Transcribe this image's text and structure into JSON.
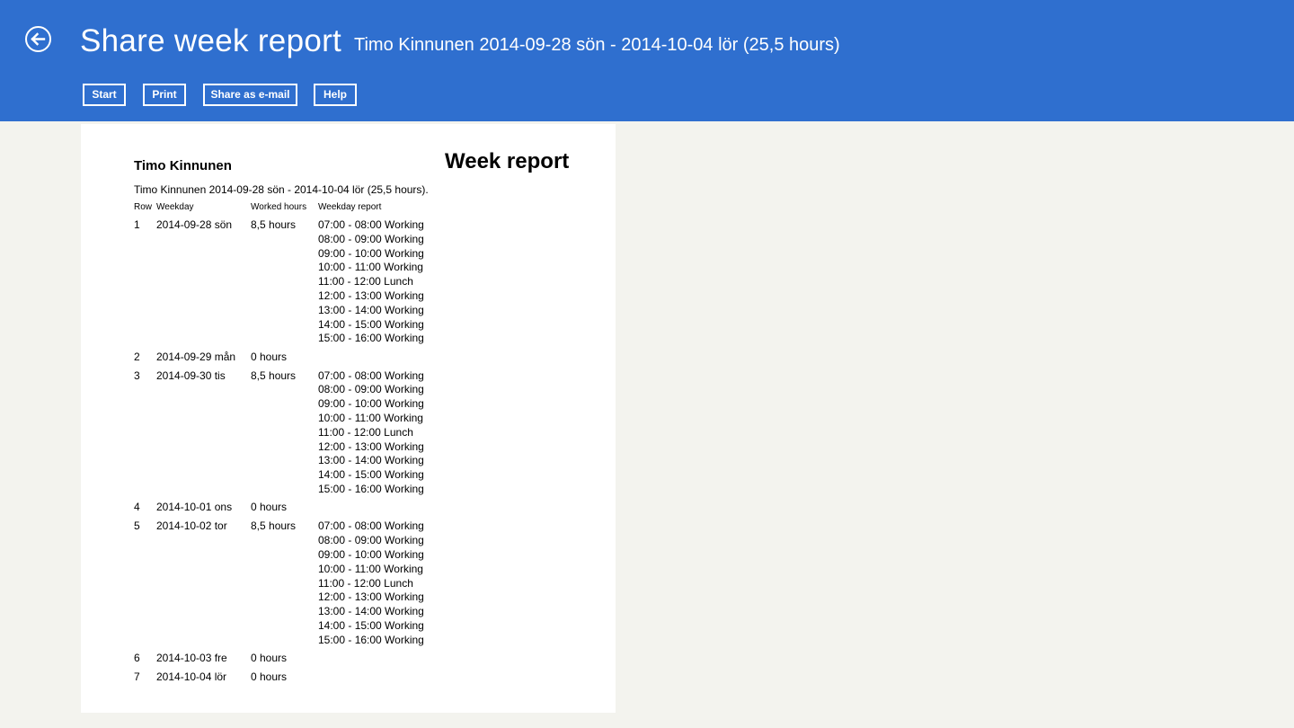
{
  "header": {
    "title": "Share week report",
    "subtitle": "Timo Kinnunen 2014-09-28 sön - 2014-10-04 lör (25,5 hours)",
    "back_icon": "back-arrow-circle-icon"
  },
  "toolbar": {
    "start_label": "Start",
    "print_label": "Print",
    "share_label": "Share as e-mail",
    "help_label": "Help"
  },
  "report": {
    "name": "Timo Kinnunen",
    "heading": "Week report",
    "summary": "Timo Kinnunen 2014-09-28 sön - 2014-10-04 lör (25,5 hours).",
    "columns": {
      "row": "Row",
      "weekday": "Weekday",
      "worked": "Worked hours",
      "report": "Weekday report"
    },
    "rows": [
      {
        "row": "1",
        "weekday": "2014-09-28 sön",
        "hours": "8,5 hours",
        "entries": [
          "07:00 - 08:00 Working",
          "08:00 - 09:00 Working",
          "09:00 - 10:00 Working",
          "10:00 - 11:00 Working",
          "11:00 - 12:00 Lunch",
          "12:00 - 13:00 Working",
          "13:00 - 14:00 Working",
          "14:00 - 15:00 Working",
          "15:00 - 16:00 Working"
        ]
      },
      {
        "row": "2",
        "weekday": "2014-09-29 mån",
        "hours": "0 hours",
        "entries": []
      },
      {
        "row": "3",
        "weekday": "2014-09-30 tis",
        "hours": "8,5 hours",
        "entries": [
          "07:00 - 08:00 Working",
          "08:00 - 09:00 Working",
          "09:00 - 10:00 Working",
          "10:00 - 11:00 Working",
          "11:00 - 12:00 Lunch",
          "12:00 - 13:00 Working",
          "13:00 - 14:00 Working",
          "14:00 - 15:00 Working",
          "15:00 - 16:00 Working"
        ]
      },
      {
        "row": "4",
        "weekday": "2014-10-01 ons",
        "hours": "0 hours",
        "entries": []
      },
      {
        "row": "5",
        "weekday": "2014-10-02 tor",
        "hours": "8,5 hours",
        "entries": [
          "07:00 - 08:00 Working",
          "08:00 - 09:00 Working",
          "09:00 - 10:00 Working",
          "10:00 - 11:00 Working",
          "11:00 - 12:00 Lunch",
          "12:00 - 13:00 Working",
          "13:00 - 14:00 Working",
          "14:00 - 15:00 Working",
          "15:00 - 16:00 Working"
        ]
      },
      {
        "row": "6",
        "weekday": "2014-10-03 fre",
        "hours": "0 hours",
        "entries": []
      },
      {
        "row": "7",
        "weekday": "2014-10-04 lör",
        "hours": "0 hours",
        "entries": []
      }
    ]
  },
  "colors": {
    "header_bg": "#2f6fcf",
    "page_bg": "#f3f3ee",
    "paper_bg": "#ffffff"
  }
}
